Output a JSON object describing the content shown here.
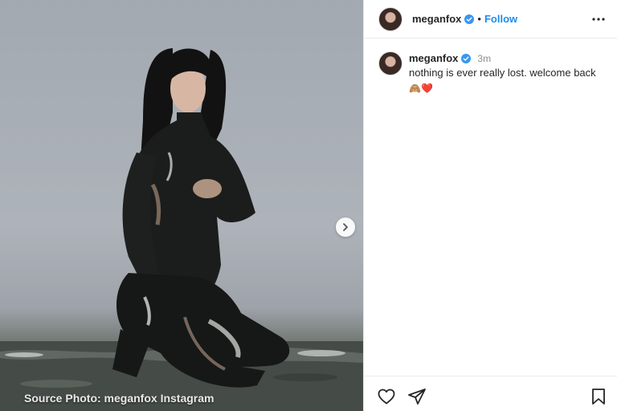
{
  "post": {
    "username": "meganfox",
    "follow_label": "Follow",
    "separator": "•",
    "caption_text": "nothing is ever really lost. welcome back",
    "caption_emojis": "🙈❤️",
    "time_ago": "3m"
  },
  "photo": {
    "watermark": "Source Photo: meganfox Instagram"
  },
  "icons": {
    "verified": "verified-badge-icon",
    "more": "more-options-icon",
    "next": "chevron-right-icon",
    "like": "heart-icon",
    "share": "paper-plane-icon",
    "save": "bookmark-icon"
  },
  "colors": {
    "accent": "#1d8cf0",
    "verified": "#3897f0",
    "text": "#262626",
    "muted": "#8e8e8e"
  }
}
